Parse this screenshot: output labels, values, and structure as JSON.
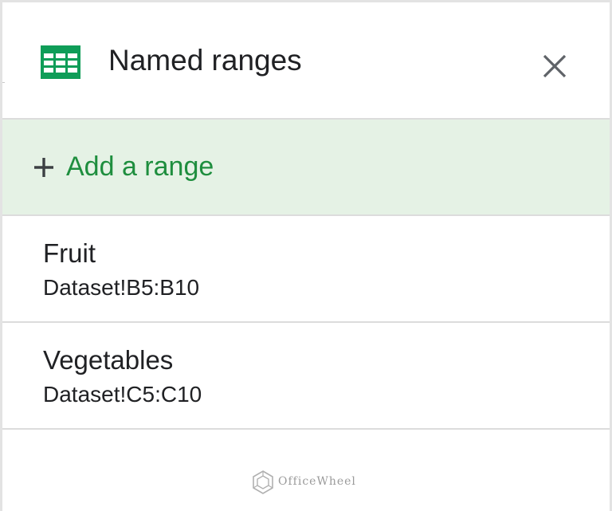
{
  "panel": {
    "title": "Named ranges",
    "icon": "google-sheets-icon",
    "close_icon": "close-icon"
  },
  "add_range": {
    "icon": "plus-icon",
    "label": "Add a range"
  },
  "ranges": [
    {
      "name": "Fruit",
      "reference": "Dataset!B5:B10"
    },
    {
      "name": "Vegetables",
      "reference": "Dataset!C5:C10"
    }
  ],
  "watermark": {
    "text": "OfficeWheel"
  },
  "colors": {
    "accent_green": "#1e8e3e",
    "add_bg": "#e5f2e5",
    "sheets_green": "#0f9d58",
    "divider": "#dcdcdc"
  }
}
